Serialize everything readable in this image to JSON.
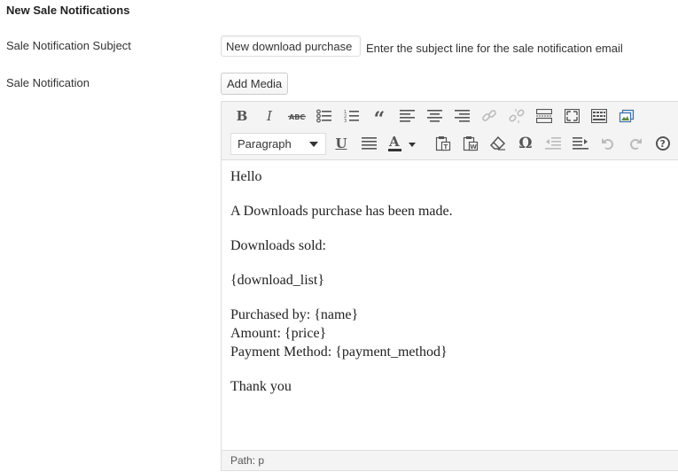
{
  "section_title": "New Sale Notifications",
  "subject": {
    "label": "Sale Notification Subject",
    "value": "New download purchase - Order #{payment_id}",
    "description": "Enter the subject line for the sale notification email"
  },
  "notification": {
    "label": "Sale Notification",
    "add_media_label": "Add Media"
  },
  "editor": {
    "format_select_value": "Paragraph",
    "toolbar_row1_icons": [
      "bold-icon",
      "italic-icon",
      "strikethrough-icon",
      "bulleted-list-icon",
      "numbered-list-icon",
      "blockquote-icon",
      "align-left-icon",
      "align-center-icon",
      "align-right-icon",
      "insert-link-icon",
      "remove-link-icon",
      "insert-more-tag-icon",
      "fullscreen-icon",
      "toolbar-toggle-icon",
      "image-gallery-icon"
    ],
    "toolbar_row2_icons": [
      "format-select",
      "underline-icon",
      "justify-icon",
      "text-color-icon",
      "paste-as-text-icon",
      "paste-from-word-icon",
      "clear-formatting-icon",
      "special-character-icon",
      "outdent-icon",
      "indent-icon",
      "undo-icon",
      "redo-icon",
      "help-icon"
    ],
    "content": {
      "greeting": "Hello",
      "intro": "A Downloads purchase has been made.",
      "sold_label": "Downloads sold:",
      "download_list": "{download_list}",
      "purchased_by": "Purchased by: {name}",
      "amount": "Amount: {price}",
      "payment_method": "Payment Method: {payment_method}",
      "closing": "Thank you"
    },
    "status_path": "Path: p"
  },
  "colors": {
    "toolbar_bg": "#f4f4f4",
    "border": "#dedede",
    "icon": "#555555",
    "icon_disabled": "#bbbbbb"
  }
}
